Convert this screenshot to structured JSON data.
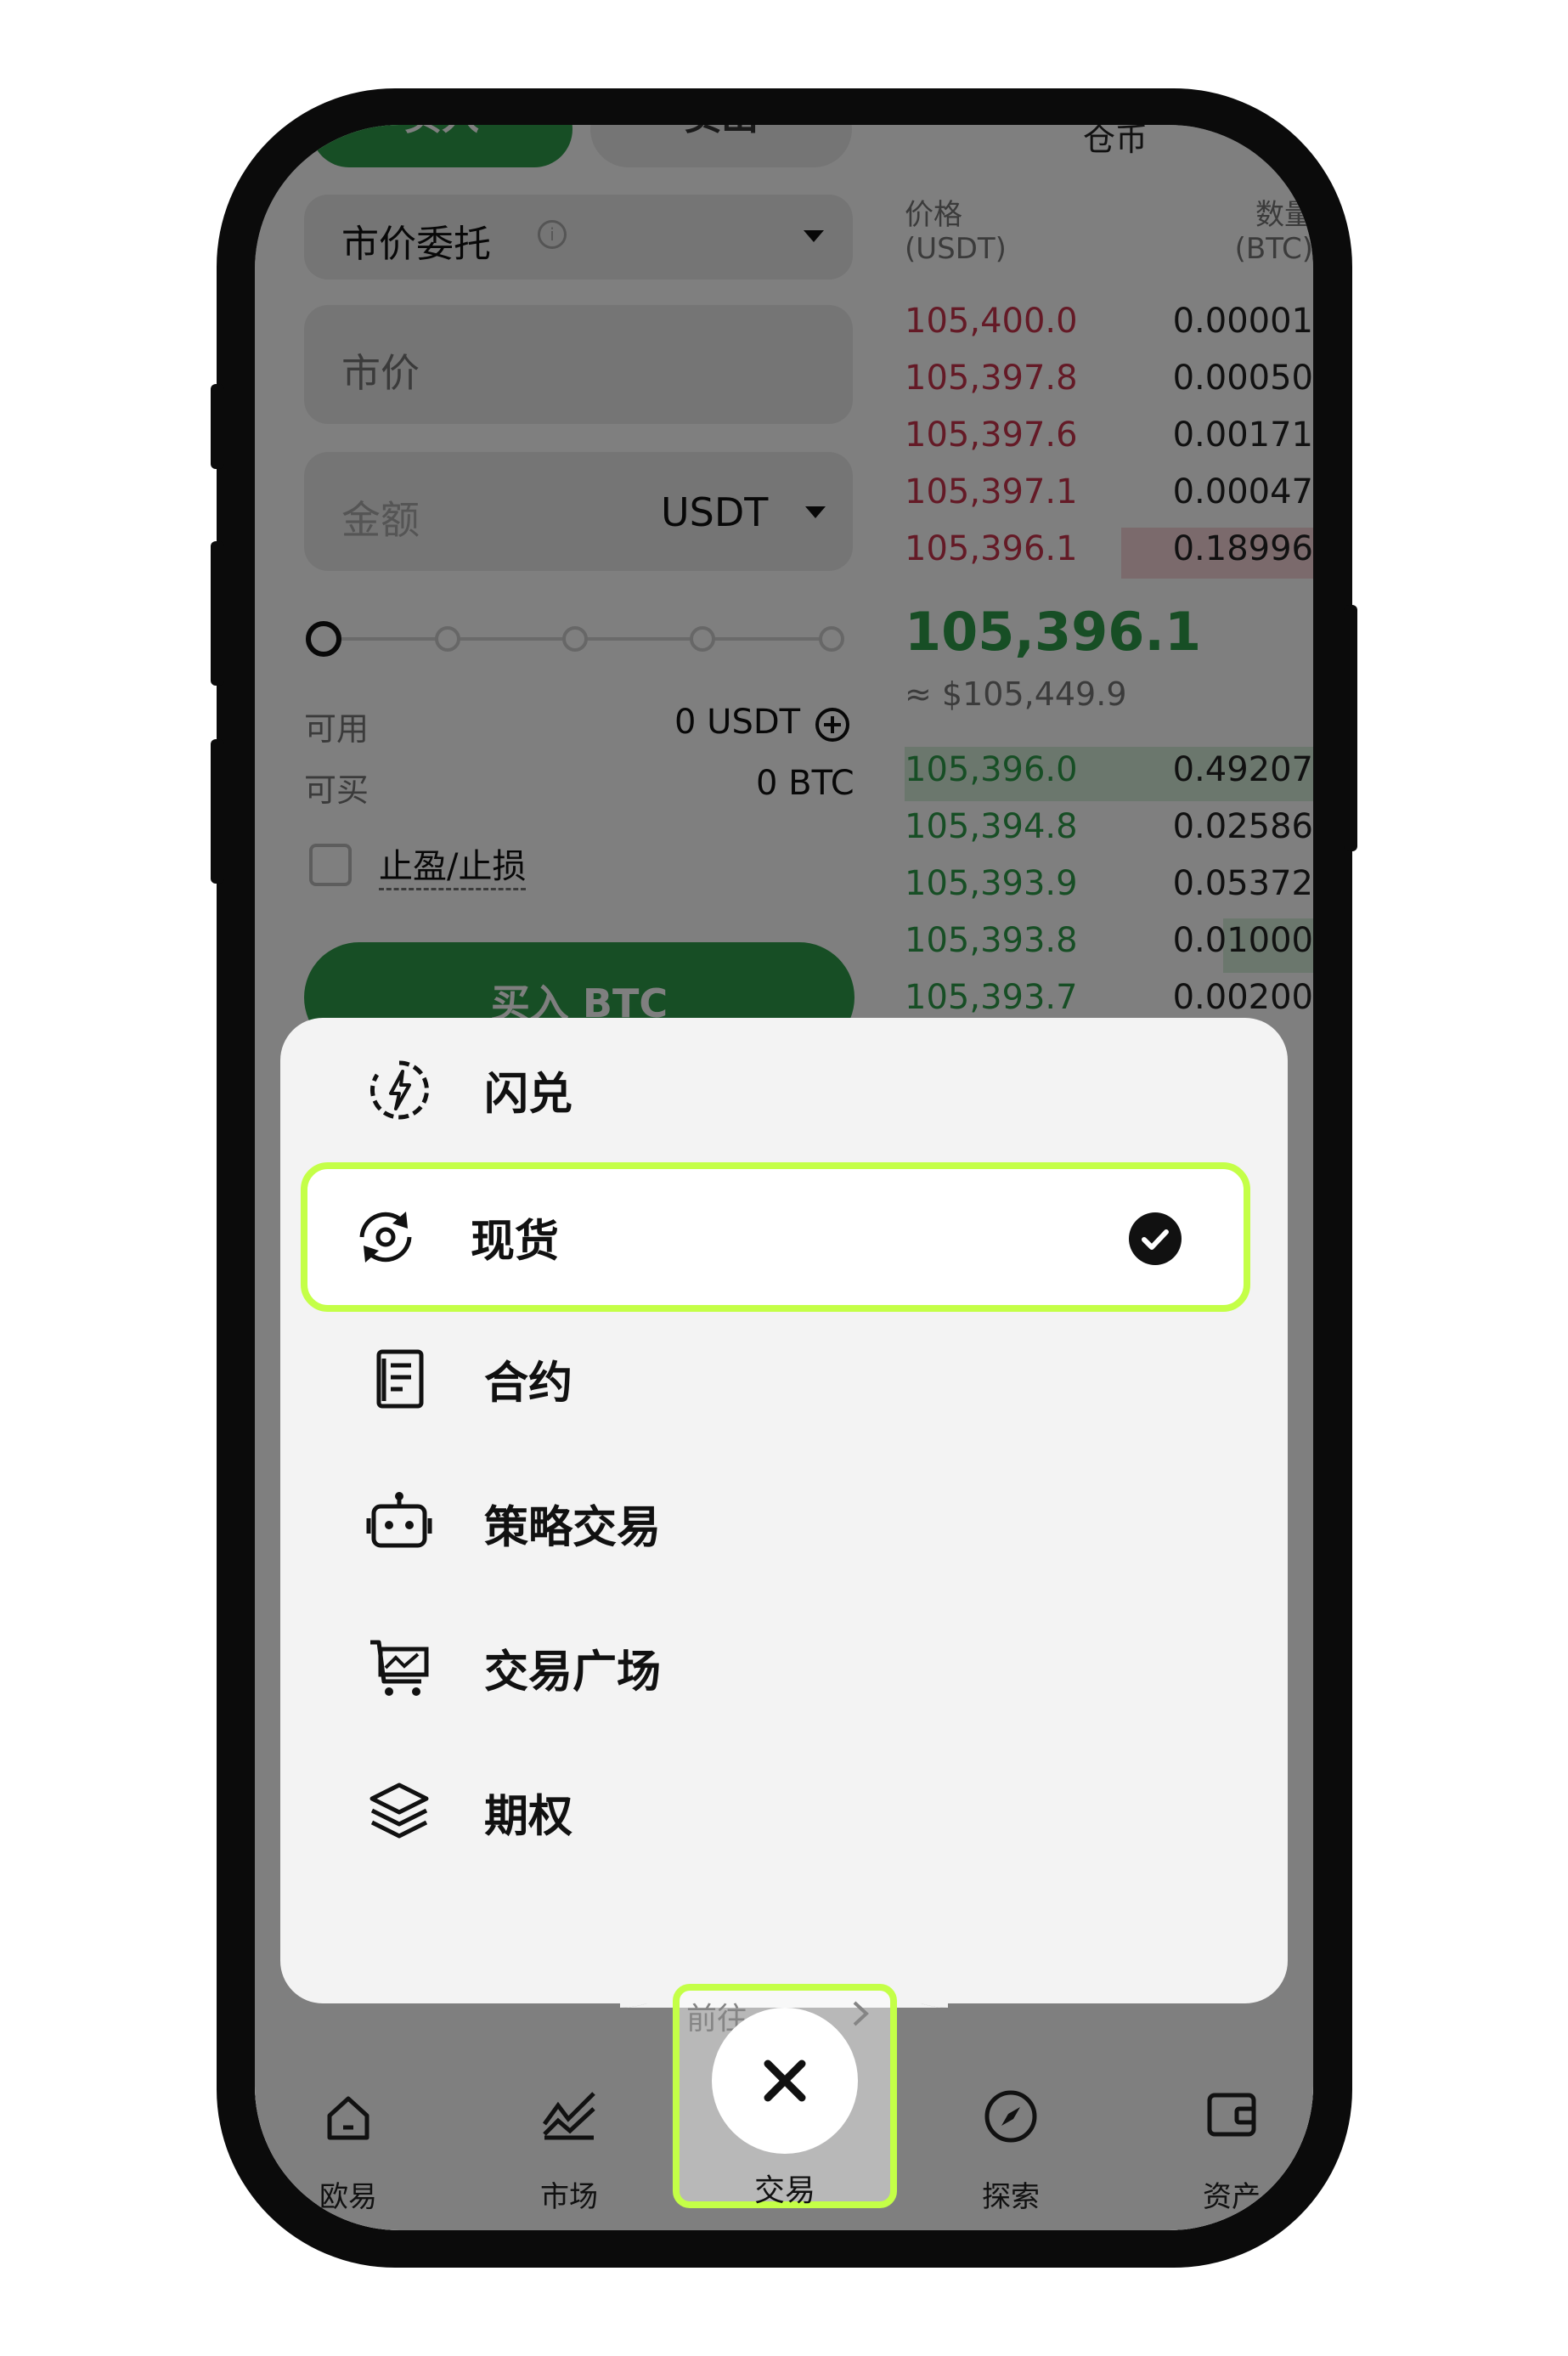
{
  "side_tabs": {
    "buy": "买入",
    "sell": "卖出",
    "cross_label": "仓币"
  },
  "order_type": {
    "label": "市价委托",
    "info_icon": "info-icon",
    "arrow_icon": "triangle-down-icon"
  },
  "price_input": {
    "placeholder": "市价"
  },
  "amount_input": {
    "placeholder": "金额",
    "currency": "USDT"
  },
  "available": {
    "label": "可用",
    "value": "0 USDT"
  },
  "can_buy": {
    "label": "可买",
    "value": "0 BTC"
  },
  "tpsl": {
    "label": "止盈/止损"
  },
  "buy_button": {
    "label": "买入 BTC"
  },
  "orderbook": {
    "price_header": "价格",
    "price_unit": "(USDT)",
    "qty_header": "数量",
    "qty_unit": "(BTC)",
    "asks": [
      {
        "price": "105,400.0",
        "qty": "0.00001"
      },
      {
        "price": "105,397.8",
        "qty": "0.00050"
      },
      {
        "price": "105,397.6",
        "qty": "0.00171"
      },
      {
        "price": "105,397.1",
        "qty": "0.00047"
      },
      {
        "price": "105,396.1",
        "qty": "0.18996"
      }
    ],
    "last_price": "105,396.1",
    "last_price_usd": "≈ $105,449.9",
    "bids": [
      {
        "price": "105,396.0",
        "qty": "0.49207"
      },
      {
        "price": "105,394.8",
        "qty": "0.02586"
      },
      {
        "price": "105,393.9",
        "qty": "0.05372"
      },
      {
        "price": "105,393.8",
        "qty": "0.01000"
      },
      {
        "price": "105,393.7",
        "qty": "0.00200"
      }
    ]
  },
  "menu": {
    "items": [
      {
        "label": "闪兑",
        "icon": "flash-swap-icon"
      },
      {
        "label": "现货",
        "icon": "spot-icon",
        "selected": true
      },
      {
        "label": "合约",
        "icon": "contract-icon"
      },
      {
        "label": "策略交易",
        "icon": "robot-icon"
      },
      {
        "label": "交易广场",
        "icon": "trade-square-icon"
      },
      {
        "label": "期权",
        "icon": "layers-icon"
      }
    ],
    "goto_label": "前往"
  },
  "bottom_nav": {
    "items": [
      {
        "label": "欧易",
        "icon": "home-icon"
      },
      {
        "label": "市场",
        "icon": "chart-icon"
      },
      {
        "label": "交易",
        "icon": "close-icon"
      },
      {
        "label": "探索",
        "icon": "compass-icon"
      },
      {
        "label": "资产",
        "icon": "wallet-icon"
      }
    ]
  },
  "colors": {
    "buy_green": "#2e9d4a",
    "sell_red": "#c8344c",
    "highlight": "#c4ff47"
  }
}
